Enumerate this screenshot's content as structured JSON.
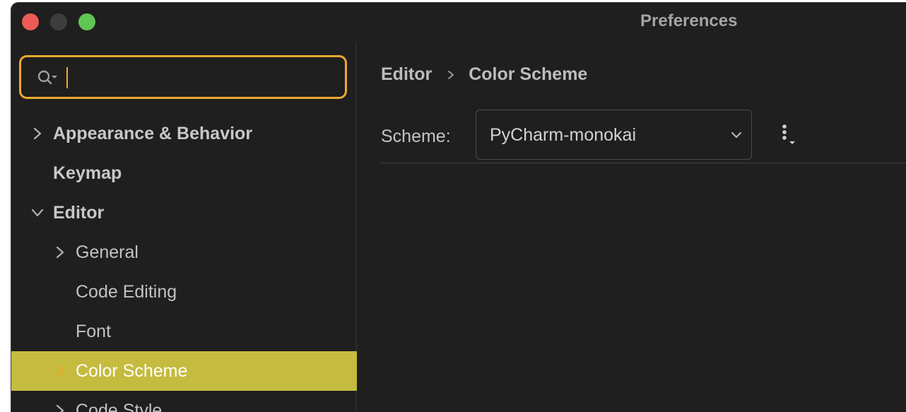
{
  "window": {
    "title": "Preferences"
  },
  "search": {
    "value": "",
    "placeholder": ""
  },
  "tree": {
    "items": [
      {
        "label": "Appearance & Behavior",
        "expanded": false
      },
      {
        "label": "Keymap"
      },
      {
        "label": "Editor",
        "expanded": true
      },
      {
        "label": "General",
        "expanded": false
      },
      {
        "label": "Code Editing"
      },
      {
        "label": "Font"
      },
      {
        "label": "Color Scheme",
        "expanded": false,
        "selected": true
      },
      {
        "label": "Code Style",
        "expanded": false
      }
    ]
  },
  "breadcrumb": {
    "parent": "Editor",
    "current": "Color Scheme"
  },
  "scheme": {
    "label": "Scheme:",
    "selected": "PyCharm-monokai"
  },
  "colors": {
    "window_bg": "#1e1f1e",
    "accent_focus": "#f0a732",
    "selection_bg": "#c5bb3e",
    "close": "#ec5b56",
    "minimize": "#3d3d3d",
    "maximize": "#61c554"
  },
  "icons": {
    "search": "search-with-options-icon",
    "more": "more-vertical-icon"
  }
}
